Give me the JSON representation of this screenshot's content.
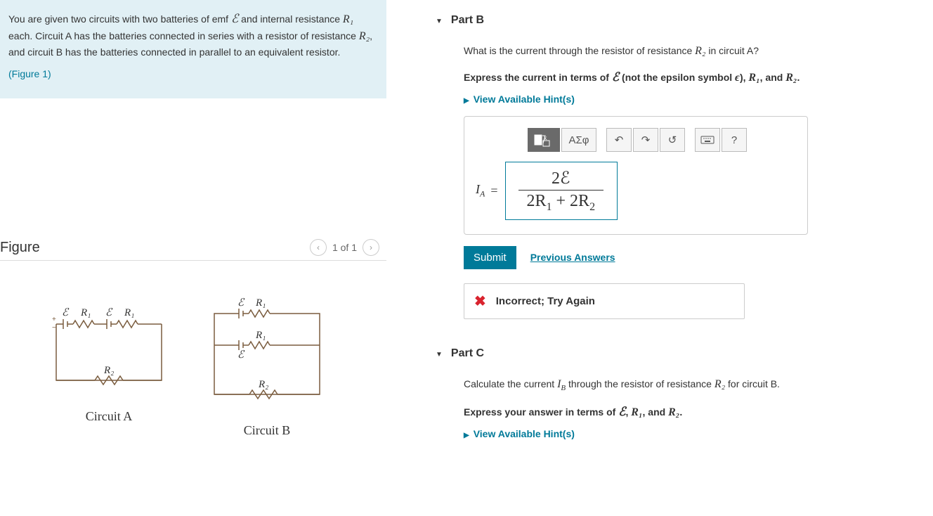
{
  "problem": {
    "text_1a": "You are given two circuits with two batteries of emf ",
    "text_1b": " and internal resistance ",
    "text_1c": " each. Circuit A has the batteries connected in series with a resistor of resistance ",
    "text_1d": ", and circuit B has the batteries connected in parallel to an equivalent resistor.",
    "figure_link": "(Figure 1)"
  },
  "figure": {
    "title": "Figure",
    "pager": "1 of 1",
    "circuit_a_label": "Circuit A",
    "circuit_b_label": "Circuit B",
    "labels": {
      "E": "ℰ",
      "R1": "R₁",
      "R2": "R₂"
    }
  },
  "partB": {
    "title": "Part B",
    "question_a": "What is the current through the resistor of resistance ",
    "question_b": " in circuit A?",
    "instruction_a": "Express the current in terms of ",
    "instruction_b": " (not the epsilon symbol ",
    "instruction_c": "), ",
    "instruction_d": ", and ",
    "instruction_e": ".",
    "hints": "View Available Hint(s)",
    "toolbar": {
      "greek": "ΑΣφ",
      "help": "?"
    },
    "answer": {
      "lhs": "I",
      "lhs_sub": "A",
      "eq": "=",
      "numerator": "2ℰ",
      "denom_a": "2R",
      "denom_sub1": "1",
      "denom_plus": " + 2R",
      "denom_sub2": "2"
    },
    "submit": "Submit",
    "prev_answers": "Previous Answers",
    "feedback": "Incorrect; Try Again"
  },
  "partC": {
    "title": "Part C",
    "question_a": "Calculate the current ",
    "question_b": " through the resistor of resistance ",
    "question_c": " for circuit B.",
    "instruction_a": "Express your answer in terms of ",
    "instruction_b": ", ",
    "instruction_c": ", and ",
    "instruction_d": ".",
    "hints": "View Available Hint(s)"
  },
  "symbols": {
    "E": "ℰ",
    "eps": "ϵ",
    "R1": "R₁",
    "R2": "R₂",
    "IB_I": "I",
    "IB_sub": "B"
  }
}
